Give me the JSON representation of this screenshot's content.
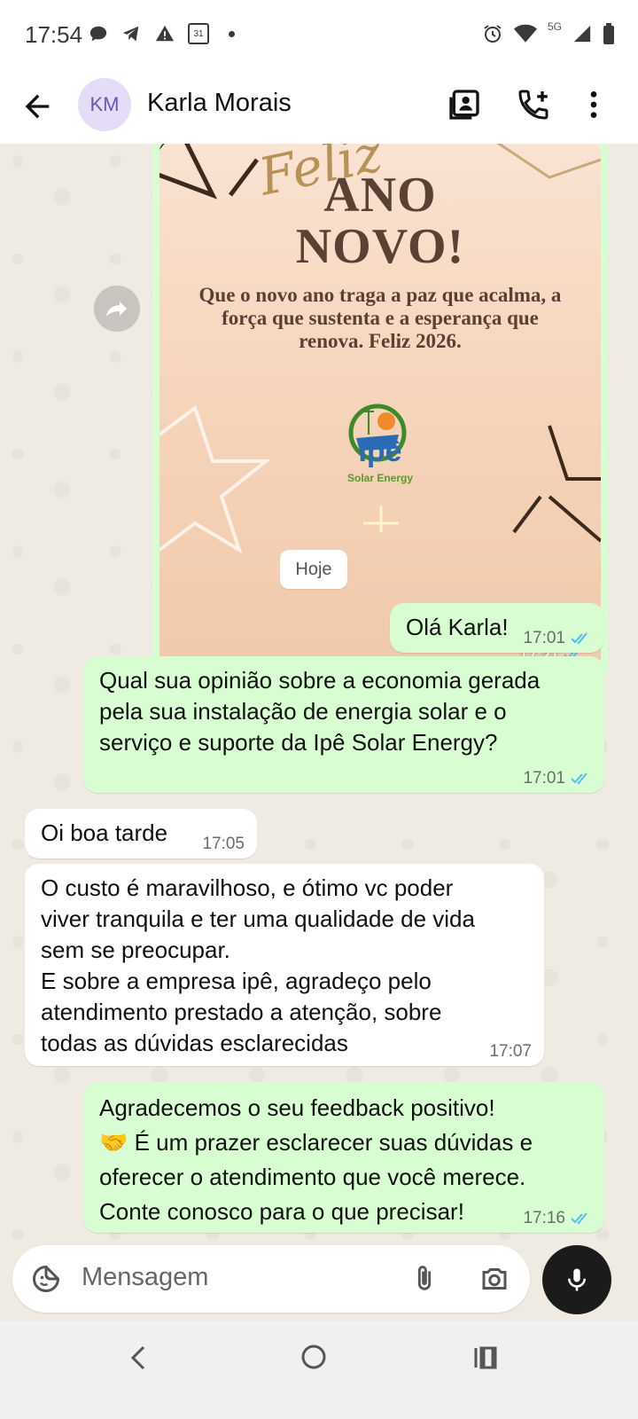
{
  "status_bar": {
    "time": "17:54",
    "network_label": "5G",
    "calendar_day": "31"
  },
  "header": {
    "avatar_initials": "KM",
    "contact_name": "Karla Morais"
  },
  "image_message": {
    "card_script": "Feliz",
    "card_title_line1": "ANO",
    "card_title_line2": "NOVO!",
    "card_text": "Que o novo ano traga a paz que acalma, a força que sustenta e a esperança que renova. Feliz 2026.",
    "logo_name": "Ipê",
    "logo_tagline": "Solar Energy",
    "time": "17:21"
  },
  "date_divider": "Hoje",
  "messages": [
    {
      "direction": "out",
      "text": "Olá Karla!",
      "time": "17:01",
      "read": true
    },
    {
      "direction": "out",
      "text": "Qual sua opinião sobre a economia gerada\npela sua instalação de energia solar e o\nserviço e suporte da Ipê Solar Energy?",
      "time": "17:01",
      "read": true
    },
    {
      "direction": "in",
      "text": "Oi boa tarde",
      "time": "17:05"
    },
    {
      "direction": "in",
      "text": "O custo é maravilhoso, e ótimo vc poder\nviver tranquila e ter uma qualidade de vida\nsem se preocupar.\nE sobre a empresa ipê, agradeço pelo\natendimento prestado a atenção, sobre\ntodas as dúvidas esclarecidas",
      "time": "17:07"
    },
    {
      "direction": "out",
      "text": "Agradecemos o seu feedback positivo!\n🤝 É um prazer esclarecer suas dúvidas e\noferecer o atendimento que você merece.\nConte conosco para o que precisar!",
      "time": "17:16",
      "read": true
    }
  ],
  "composer": {
    "placeholder": "Mensagem"
  },
  "colors": {
    "outgoing_bubble": "#d9fdd3",
    "incoming_bubble": "#ffffff",
    "read_ticks": "#53bdeb",
    "chat_bg": "#efeae2"
  }
}
